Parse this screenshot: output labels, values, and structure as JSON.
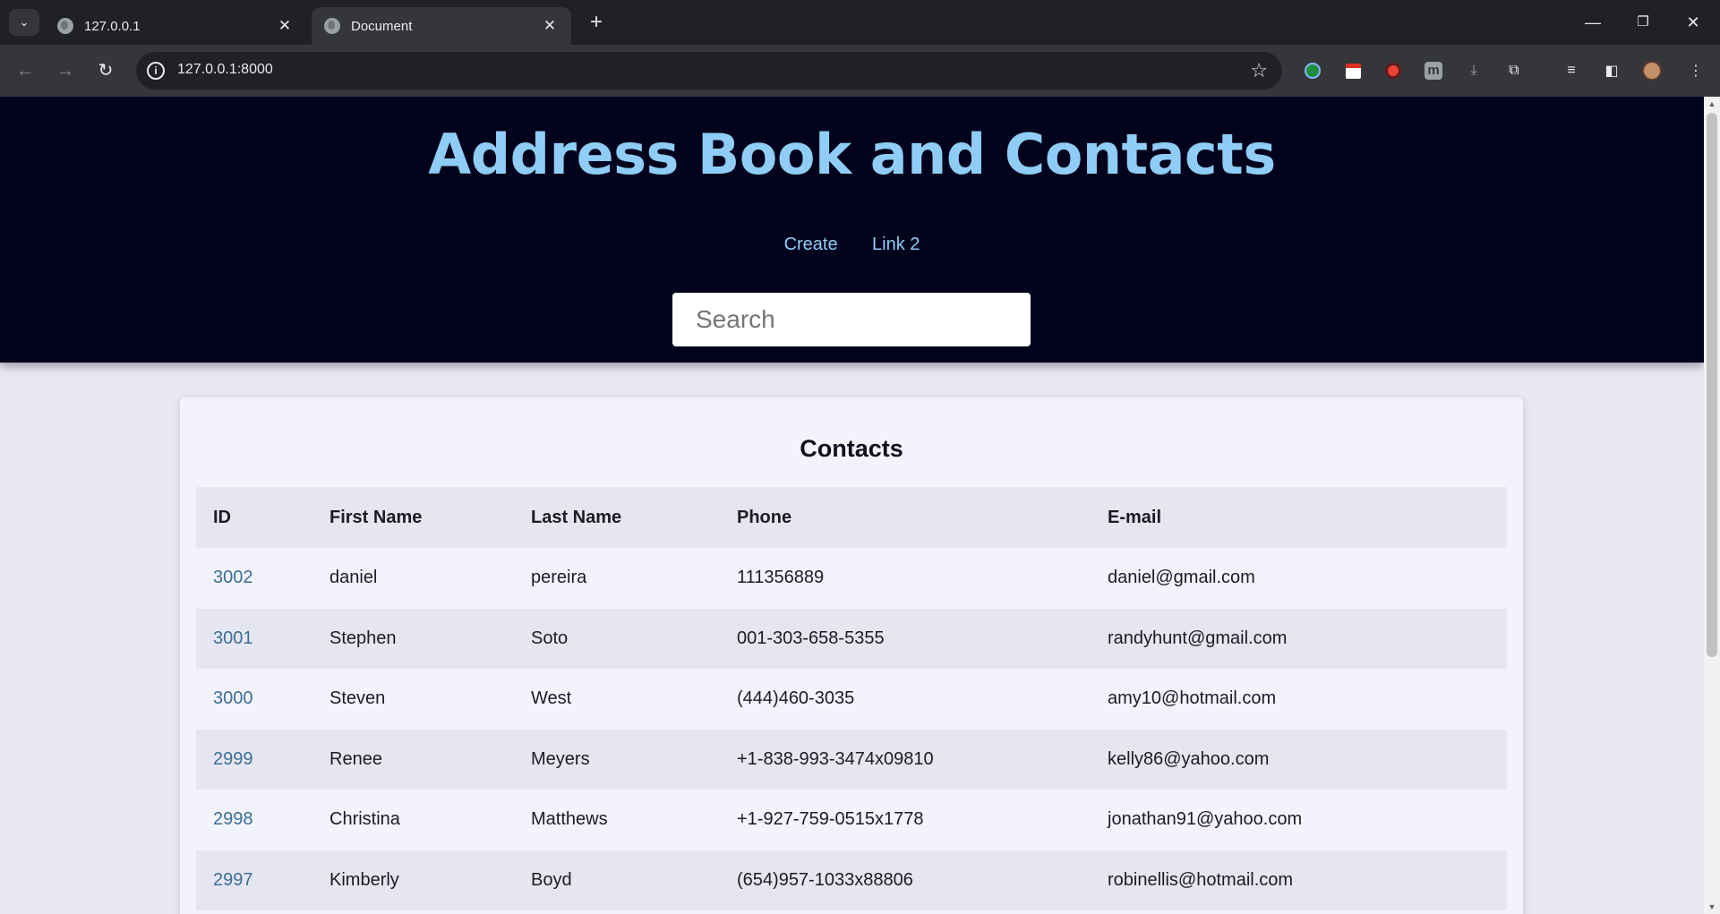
{
  "browser": {
    "tabs": [
      {
        "title": "127.0.0.1",
        "active": false
      },
      {
        "title": "Document",
        "active": true
      }
    ],
    "url": "127.0.0.1:8000"
  },
  "site": {
    "title": "Address Book and Contacts",
    "nav": {
      "create": "Create",
      "link2": "Link 2"
    },
    "search_placeholder": "Search"
  },
  "contacts": {
    "heading": "Contacts",
    "columns": {
      "id": "ID",
      "first": "First Name",
      "last": "Last Name",
      "phone": "Phone",
      "email": "E-mail"
    },
    "rows": [
      {
        "id": "3002",
        "first": "daniel",
        "last": "pereira",
        "phone": "111356889",
        "email": "daniel@gmail.com"
      },
      {
        "id": "3001",
        "first": "Stephen",
        "last": "Soto",
        "phone": "001-303-658-5355",
        "email": "randyhunt@gmail.com"
      },
      {
        "id": "3000",
        "first": "Steven",
        "last": "West",
        "phone": "(444)460-3035",
        "email": "amy10@hotmail.com"
      },
      {
        "id": "2999",
        "first": "Renee",
        "last": "Meyers",
        "phone": "+1-838-993-3474x09810",
        "email": "kelly86@yahoo.com"
      },
      {
        "id": "2998",
        "first": "Christina",
        "last": "Matthews",
        "phone": "+1-927-759-0515x1778",
        "email": "jonathan91@yahoo.com"
      },
      {
        "id": "2997",
        "first": "Kimberly",
        "last": "Boyd",
        "phone": "(654)957-1033x88806",
        "email": "robinellis@hotmail.com"
      }
    ]
  },
  "colors": {
    "header_bg": "#02021c",
    "title": "#8fcdf6",
    "link": "#3c6e94",
    "page_bg": "#e9e8f3"
  }
}
